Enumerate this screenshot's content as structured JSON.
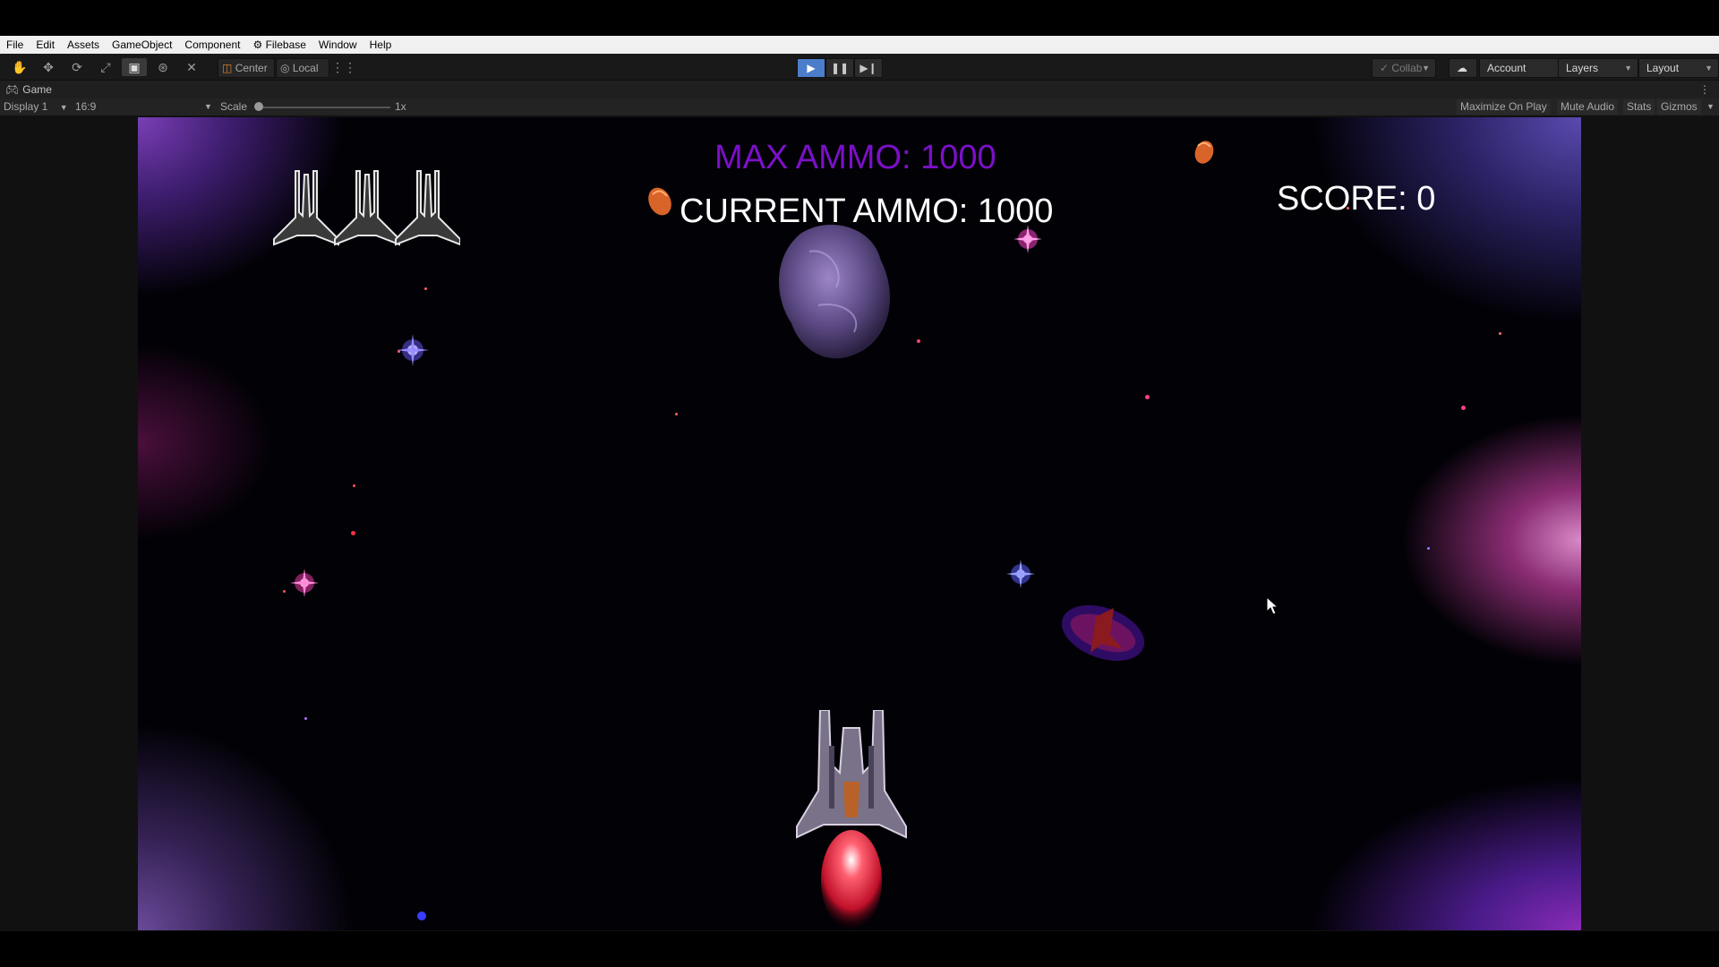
{
  "menu": [
    "File",
    "Edit",
    "Assets",
    "GameObject",
    "Component",
    "Filebase",
    "Window",
    "Help"
  ],
  "toolbar": {
    "pivot_center": "Center",
    "pivot_local": "Local",
    "collab": "Collab",
    "account": "Account",
    "layers": "Layers",
    "layout": "Layout"
  },
  "tab": {
    "title": "Game"
  },
  "gamebar": {
    "display": "Display 1",
    "aspect": "16:9",
    "scale_label": "Scale",
    "scale_value": "1x",
    "maximize_on_play": "Maximize On Play",
    "mute_audio": "Mute Audio",
    "stats": "Stats",
    "gizmos": "Gizmos"
  },
  "hud": {
    "max_ammo": "MAX AMMO: 1000",
    "current_ammo": "CURRENT AMMO: 1000",
    "score": "SCORE: 0",
    "lives": 3
  },
  "colors": {
    "play_active": "#4c7dca",
    "max_ammo_text": "#7b10c8",
    "hud_text": "#ffffff"
  }
}
